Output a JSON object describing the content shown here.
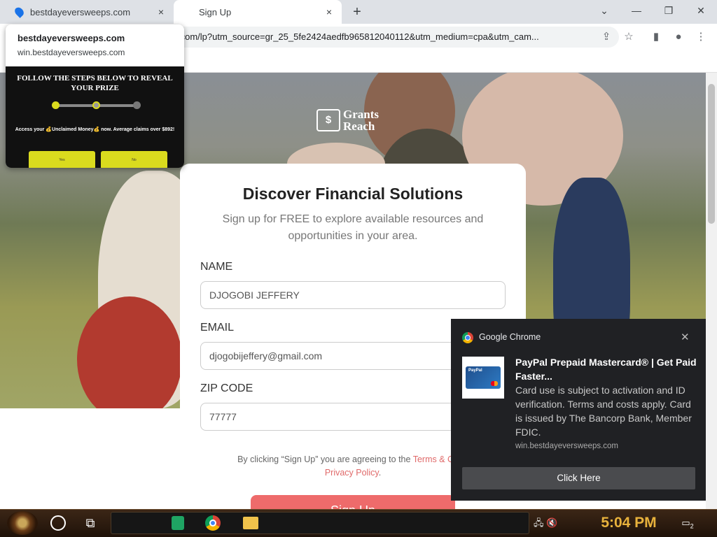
{
  "tabs": [
    {
      "title": "bestdayeversweeps.com"
    },
    {
      "title": "Sign Up"
    }
  ],
  "tab_close_icon": "×",
  "new_tab_icon": "+",
  "window_controls": {
    "dropdown": "⌄",
    "minimize": "—",
    "restore": "❐",
    "close": "✕"
  },
  "address_bar": {
    "url": ".com/lp?utm_source=gr_25_5fe2424aedfb965812040112&utm_medium=cpa&utm_cam..."
  },
  "toolbar_icons": {
    "share": "⇪",
    "bookmark": "☆",
    "sidepanel": "▮",
    "profile": "●",
    "menu": "⋮"
  },
  "site_popup": {
    "domain": "bestdayeversweeps.com",
    "subdomain": "win.bestdayeversweeps.com",
    "preview": {
      "title": "FOLLOW THE STEPS BELOW TO REVEAL YOUR PRIZE",
      "message": "Access your 💰Unclaimed Money💰 now. Average claims over $892!",
      "yes_label": "Yes",
      "no_label": "No"
    }
  },
  "logo": {
    "icon_text": "$",
    "name_line1": "Grants",
    "name_line2": "Reach"
  },
  "form": {
    "title": "Discover Financial Solutions",
    "subtitle": "Sign up for FREE to explore available resources and opportunities in your area.",
    "name_label": "NAME",
    "name_value": "DJOGOBI JEFFERY",
    "email_label": "EMAIL",
    "email_value": "djogobijeffery@gmail.com",
    "zip_label": "ZIP CODE",
    "zip_value": "77777",
    "terms_prefix": "By clicking “Sign Up” you are agreeing to the ",
    "terms_link": "Terms & Cond",
    "privacy_link": "Privacy Policy",
    "terms_suffix": ".",
    "submit_label": "Sign Up"
  },
  "notification": {
    "app": "Google Chrome",
    "close_icon": "✕",
    "title": "PayPal Prepaid Mastercard® | Get Paid Faster...",
    "body": "Card use is subject to activation and ID verification. Terms and costs apply. Card is issued by The Bancorp Bank, Member FDIC.",
    "source": "win.bestdayeversweeps.com",
    "button_label": "Click Here",
    "image_label": "PayPal"
  },
  "taskbar": {
    "clock": "5:04 PM",
    "notification_count": "2",
    "task_view_icon": "⧉",
    "tray_icons": "🖧 🔇"
  }
}
